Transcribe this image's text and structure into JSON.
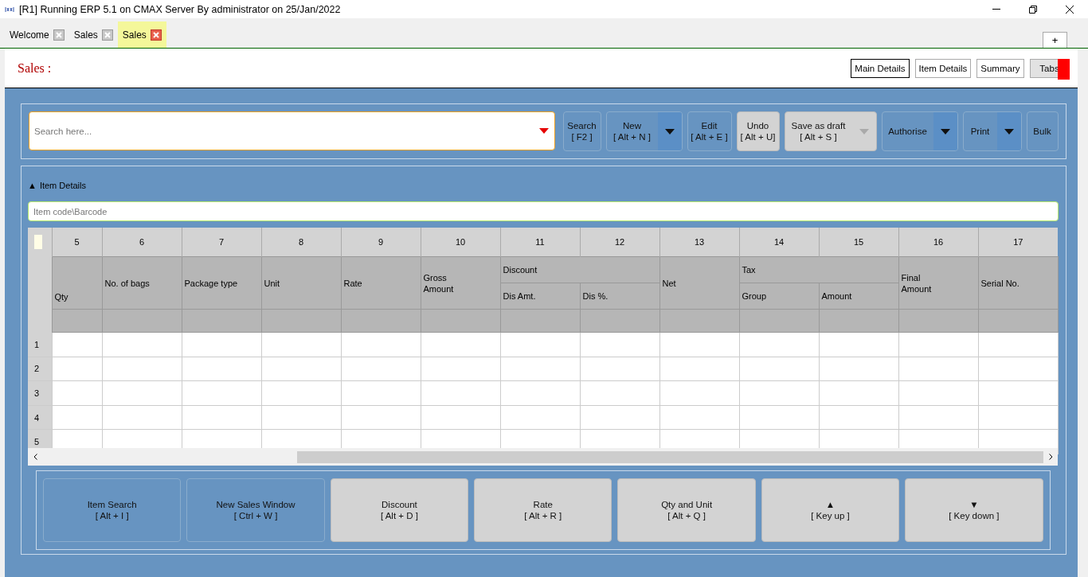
{
  "window": {
    "title": "[R1] Running ERP 5.1 on CMAX Server By administrator on 25/Jan/2022"
  },
  "tabs": [
    {
      "label": "Welcome",
      "selected": false
    },
    {
      "label": "Sales",
      "selected": false
    },
    {
      "label": "Sales",
      "selected": true
    }
  ],
  "new_tab_button": "+",
  "page_title": "Sales :",
  "view_buttons": [
    {
      "label": "Main Details",
      "selected": true
    },
    {
      "label": "Item Details",
      "selected": false
    },
    {
      "label": "Summary",
      "selected": false
    },
    {
      "label": "Tabs",
      "selected": false
    }
  ],
  "search": {
    "placeholder": "Search here..."
  },
  "toolbar": [
    {
      "label": "Search",
      "shortcut": "[ F2 ]",
      "kind": "primary",
      "dropdown": false
    },
    {
      "label": "New",
      "shortcut": "[ Alt + N ]",
      "kind": "primary",
      "dropdown": true
    },
    {
      "label": "Edit",
      "shortcut": "[ Alt + E ]",
      "kind": "primary",
      "dropdown": false
    },
    {
      "label": "Undo",
      "shortcut": "[ Alt + U]",
      "kind": "plain",
      "dropdown": false
    },
    {
      "label": "Save as draft",
      "shortcut": "[ Alt + S ]",
      "kind": "plain",
      "dropdown": true
    },
    {
      "label": "Authorise",
      "kind": "primary",
      "dropdown": true
    },
    {
      "label": "Print",
      "kind": "primary",
      "dropdown": true
    },
    {
      "label": "Bulk",
      "kind": "primary",
      "dropdown": false
    }
  ],
  "item_details": {
    "toggle": "▲",
    "title": "Item Details",
    "expanded": true,
    "placeholder": "Item code\\Barcode"
  },
  "table": {
    "column_numbers": [
      "5",
      "6",
      "7",
      "8",
      "9",
      "10",
      "11",
      "12",
      "13",
      "14",
      "15",
      "16",
      "17"
    ],
    "headers": [
      {
        "label": "Qty"
      },
      {
        "label": "No. of bags"
      },
      {
        "label": "Package type"
      },
      {
        "label": "Unit"
      },
      {
        "label": "Rate"
      },
      {
        "label": "Gross\nAmount"
      },
      {
        "label": "Discount",
        "children": [
          {
            "label": "Dis Amt."
          },
          {
            "label": "Dis %."
          }
        ]
      },
      {
        "label": "Net"
      },
      {
        "label": "Tax",
        "children": [
          {
            "label": "Group"
          },
          {
            "label": "Amount"
          }
        ]
      },
      {
        "label": "Final\nAmount"
      },
      {
        "label": "Serial No."
      }
    ],
    "rows": [
      "1",
      "2",
      "3",
      "4",
      "5"
    ]
  },
  "shortcuts": [
    {
      "label": "Item Search",
      "shortcut": "[ Alt + I ]",
      "kind": "primary"
    },
    {
      "label": "New Sales Window",
      "shortcut": "[ Ctrl + W ]",
      "kind": "primary"
    },
    {
      "label": "Discount",
      "shortcut": "[ Alt + D ]",
      "kind": "plain"
    },
    {
      "label": "Rate",
      "shortcut": "[ Alt + R ]",
      "kind": "plain"
    },
    {
      "label": "Qty and Unit",
      "shortcut": "[ Alt + Q ]",
      "kind": "plain"
    },
    {
      "label": "▲",
      "shortcut": "[ Key up ]",
      "kind": "plain"
    },
    {
      "label": "▼",
      "shortcut": "[ Key down ]",
      "kind": "plain"
    }
  ]
}
